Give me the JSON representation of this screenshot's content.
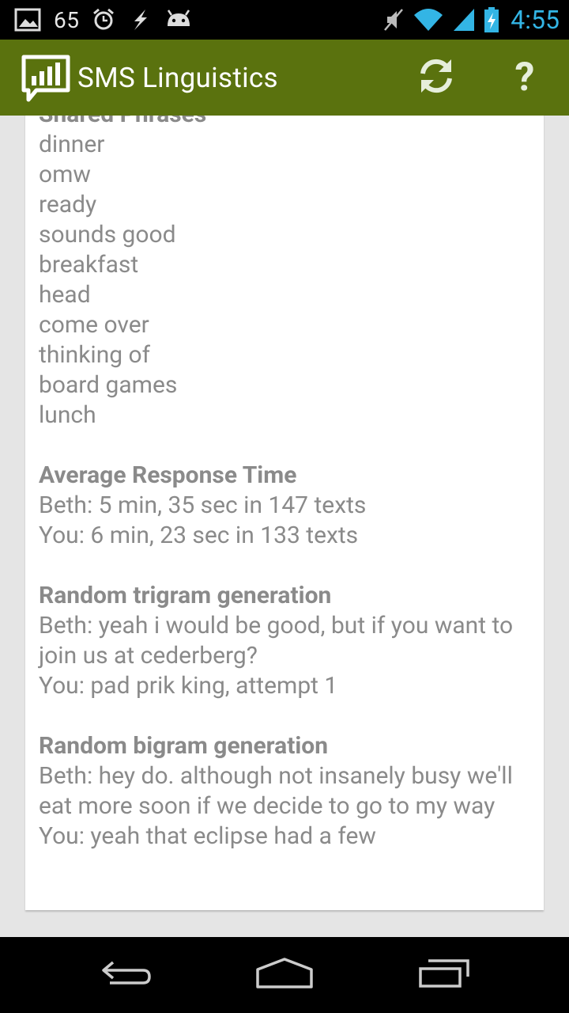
{
  "status_bar": {
    "notification_count": "65",
    "time": "4:55",
    "icons": [
      "image-notification-icon",
      "alarm-icon",
      "flash-icon",
      "android-icon",
      "mute-icon",
      "wifi-icon",
      "signal-icon",
      "battery-charging-icon"
    ]
  },
  "action_bar": {
    "title": "SMS Linguistics",
    "refresh_icon": "refresh-icon",
    "help_label": "?"
  },
  "card": {
    "shared_phrases": {
      "heading": "Shared Phrases",
      "items": [
        "dinner",
        "omw",
        "ready",
        "sounds good",
        "breakfast",
        "head",
        "come over",
        "thinking of",
        "board games",
        "lunch"
      ]
    },
    "response_time": {
      "heading": "Average Response Time",
      "lines": [
        "Beth: 5 min, 35 sec in 147 texts",
        "You: 6 min, 23 sec in 133 texts"
      ]
    },
    "trigram": {
      "heading": "Random trigram generation",
      "beth": "Beth: yeah i would be good, but if you want to join us at cederberg?",
      "you": "You: pad prik king, attempt 1"
    },
    "bigram": {
      "heading": "Random bigram generation",
      "beth": "Beth: hey do. although not insanely busy we'll eat more soon if we decide to go to my way",
      "you": "You: yeah that eclipse had a few"
    }
  },
  "nav_bar": {
    "icons": [
      "back-icon",
      "home-icon",
      "recent-apps-icon"
    ]
  },
  "colors": {
    "action_bar": "#5a720e",
    "text": "#8a8a8a",
    "clock": "#33b5e5"
  }
}
